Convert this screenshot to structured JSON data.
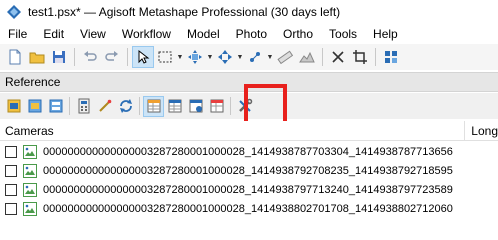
{
  "window": {
    "title": "test1.psx* — Agisoft Metashape Professional (30 days left)",
    "app_icon": "metashape-app-icon"
  },
  "menu": {
    "items": [
      "File",
      "Edit",
      "View",
      "Workflow",
      "Model",
      "Photo",
      "Ortho",
      "Tools",
      "Help"
    ]
  },
  "panel": {
    "title": "Reference"
  },
  "table": {
    "columns": [
      "Cameras",
      "Long"
    ],
    "rows": [
      {
        "checked": false,
        "label": "000000000000000003287280001000028_1414938787703304_1414938787713656"
      },
      {
        "checked": false,
        "label": "000000000000000003287280001000028_1414938792708235_1414938792718595"
      },
      {
        "checked": false,
        "label": "000000000000000003287280001000028_1414938797713240_1414938797723589"
      },
      {
        "checked": false,
        "label": "000000000000000003287280001000028_1414938802701708_1414938802712060"
      }
    ]
  },
  "colors": {
    "highlight": "#e8201c",
    "toolbar_bg": "#f5f5f5",
    "panel_header_bg": "#e6e6e6",
    "active_button_bg": "#cce4f7"
  }
}
